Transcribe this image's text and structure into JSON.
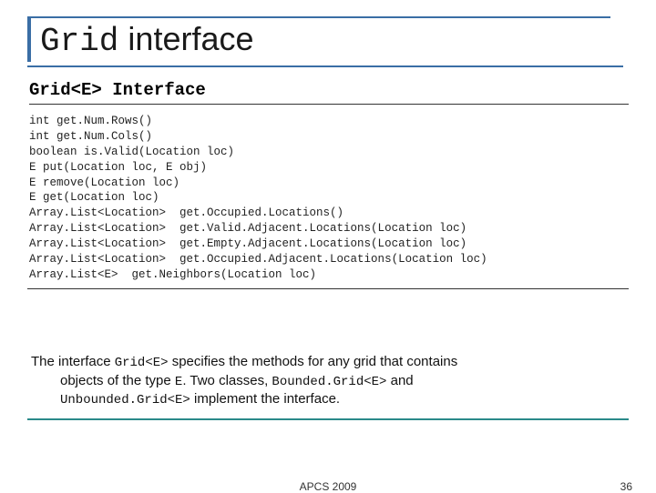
{
  "title": {
    "mono": "Grid",
    "rest": " interface"
  },
  "code": {
    "heading": "Grid<E> Interface",
    "lines": [
      "int get.Num.Rows()",
      "int get.Num.Cols()",
      "boolean is.Valid(Location loc)",
      "E put(Location loc, E obj)",
      "E remove(Location loc)",
      "E get(Location loc)",
      "Array.List<Location>  get.Occupied.Locations()",
      "Array.List<Location>  get.Valid.Adjacent.Locations(Location loc)",
      "Array.List<Location>  get.Empty.Adjacent.Locations(Location loc)",
      "Array.List<Location>  get.Occupied.Adjacent.Locations(Location loc)",
      "Array.List<E>  get.Neighbors(Location loc)"
    ]
  },
  "desc": {
    "t1": "The interface ",
    "m1": "Grid<E>",
    "t2": " specifies the methods for any grid that contains",
    "t3": "objects of the type ",
    "m2": "E",
    "t4": ". Two classes, ",
    "m3": "Bounded.Grid<E>",
    "t5": " and",
    "m4": "Unbounded.Grid<E>",
    "t6": " implement the interface."
  },
  "footer": {
    "center": "APCS 2009",
    "right": "36"
  }
}
